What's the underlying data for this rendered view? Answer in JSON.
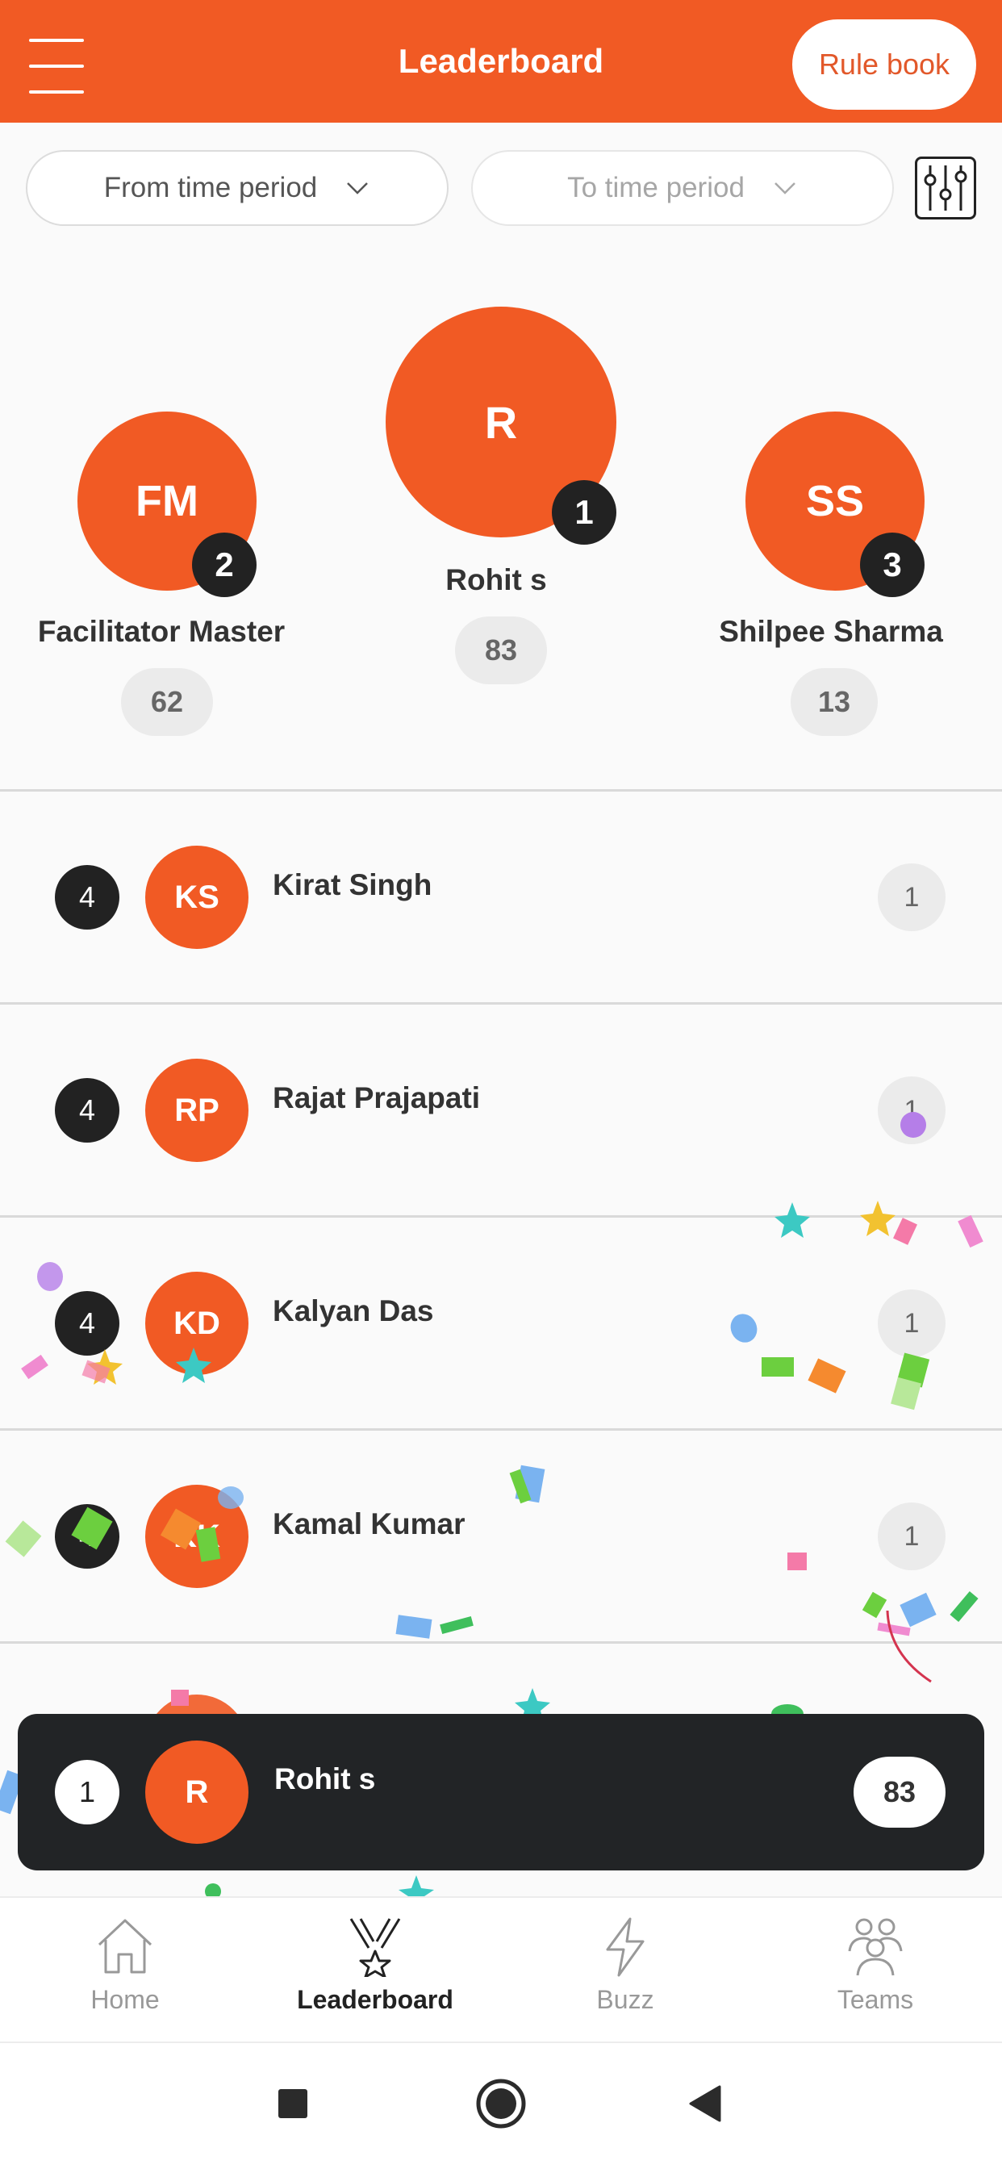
{
  "header": {
    "title": "Leaderboard",
    "rulebook_label": "Rule book",
    "accent_color": "#f15a24"
  },
  "filters": {
    "from_label": "From time period",
    "to_label": "To time period"
  },
  "podium": [
    {
      "initials": "R",
      "name": "Rohit s",
      "rank": "1",
      "score": "83"
    },
    {
      "initials": "FM",
      "name": "Facilitator Master",
      "rank": "2",
      "score": "62"
    },
    {
      "initials": "SS",
      "name": "Shilpee Sharma",
      "rank": "3",
      "score": "13"
    }
  ],
  "list": [
    {
      "rank": "4",
      "initials": "KS",
      "name": "Kirat Singh",
      "score": "1"
    },
    {
      "rank": "4",
      "initials": "RP",
      "name": "Rajat Prajapati",
      "score": "1"
    },
    {
      "rank": "4",
      "initials": "KD",
      "name": "Kalyan Das",
      "score": "1"
    },
    {
      "rank": "4",
      "initials": "KK",
      "name": "Kamal Kumar",
      "score": "1"
    }
  ],
  "current_user": {
    "rank": "1",
    "initials": "R",
    "name": "Rohit s",
    "score": "83"
  },
  "nav": {
    "items": [
      {
        "label": "Home",
        "icon": "home-icon"
      },
      {
        "label": "Leaderboard",
        "icon": "trophy-medal-icon",
        "active": true
      },
      {
        "label": "Buzz",
        "icon": "lightning-icon"
      },
      {
        "label": "Teams",
        "icon": "team-icon"
      }
    ]
  }
}
